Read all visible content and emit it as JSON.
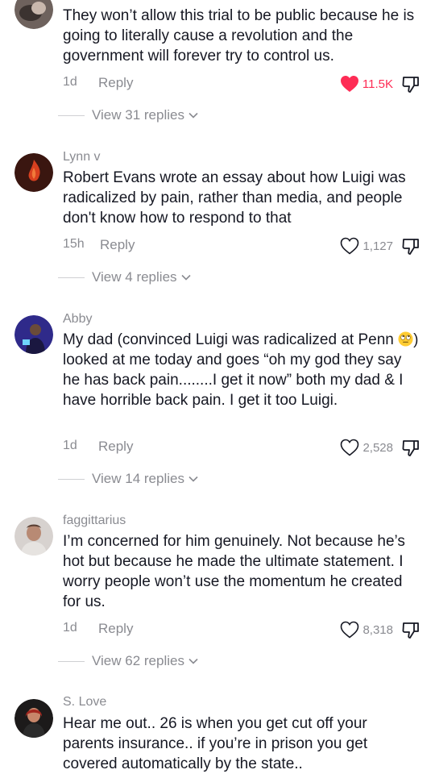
{
  "comments": [
    {
      "username": "",
      "text": "They won’t allow this trial to be public because he is going to literally cause a revolution and the government will forever try to control us.",
      "age": "1d",
      "reply_label": "Reply",
      "likes": "11.5K",
      "liked": true,
      "view_replies": "View 31 replies"
    },
    {
      "username": "Lynn v",
      "text": "Robert Evans wrote an essay about how Luigi was radicalized by pain, rather than media, and people don't know how to respond to that",
      "age": "15h",
      "reply_label": "Reply",
      "likes": "1,127",
      "liked": false,
      "view_replies": "View 4 replies"
    },
    {
      "username": "Abby",
      "text_before_emoji": "My dad (convinced Luigi was radicalized at Penn ",
      "text_after_emoji": ") looked at me today and goes “oh my god they say he has back pain........I get it now” both my dad & I have horrible back pain. I get it too Luigi.",
      "age": "1d",
      "reply_label": "Reply",
      "likes": "2,528",
      "liked": false,
      "view_replies": "View 14 replies"
    },
    {
      "username": "faggittarius",
      "text": "I’m concerned for him genuinely. Not because he’s hot but because he made the ultimate statement. I worry people won’t use the momentum he created for us.",
      "age": "1d",
      "reply_label": "Reply",
      "likes": "8,318",
      "liked": false,
      "view_replies": "View 62 replies"
    },
    {
      "username": "S. Love",
      "text": "Hear me out.. 26 is when you get cut off your parents insurance.. if you’re in prison you get covered automatically by the state..",
      "age": "",
      "reply_label": "",
      "likes": "",
      "liked": false,
      "view_replies": ""
    }
  ],
  "icons": {
    "heart": "heart-icon",
    "dislike": "thumbs-down-icon",
    "chevron": "chevron-down-icon"
  },
  "colors": {
    "liked_heart": "#fe2c55",
    "muted_text": "#8a8b91"
  }
}
